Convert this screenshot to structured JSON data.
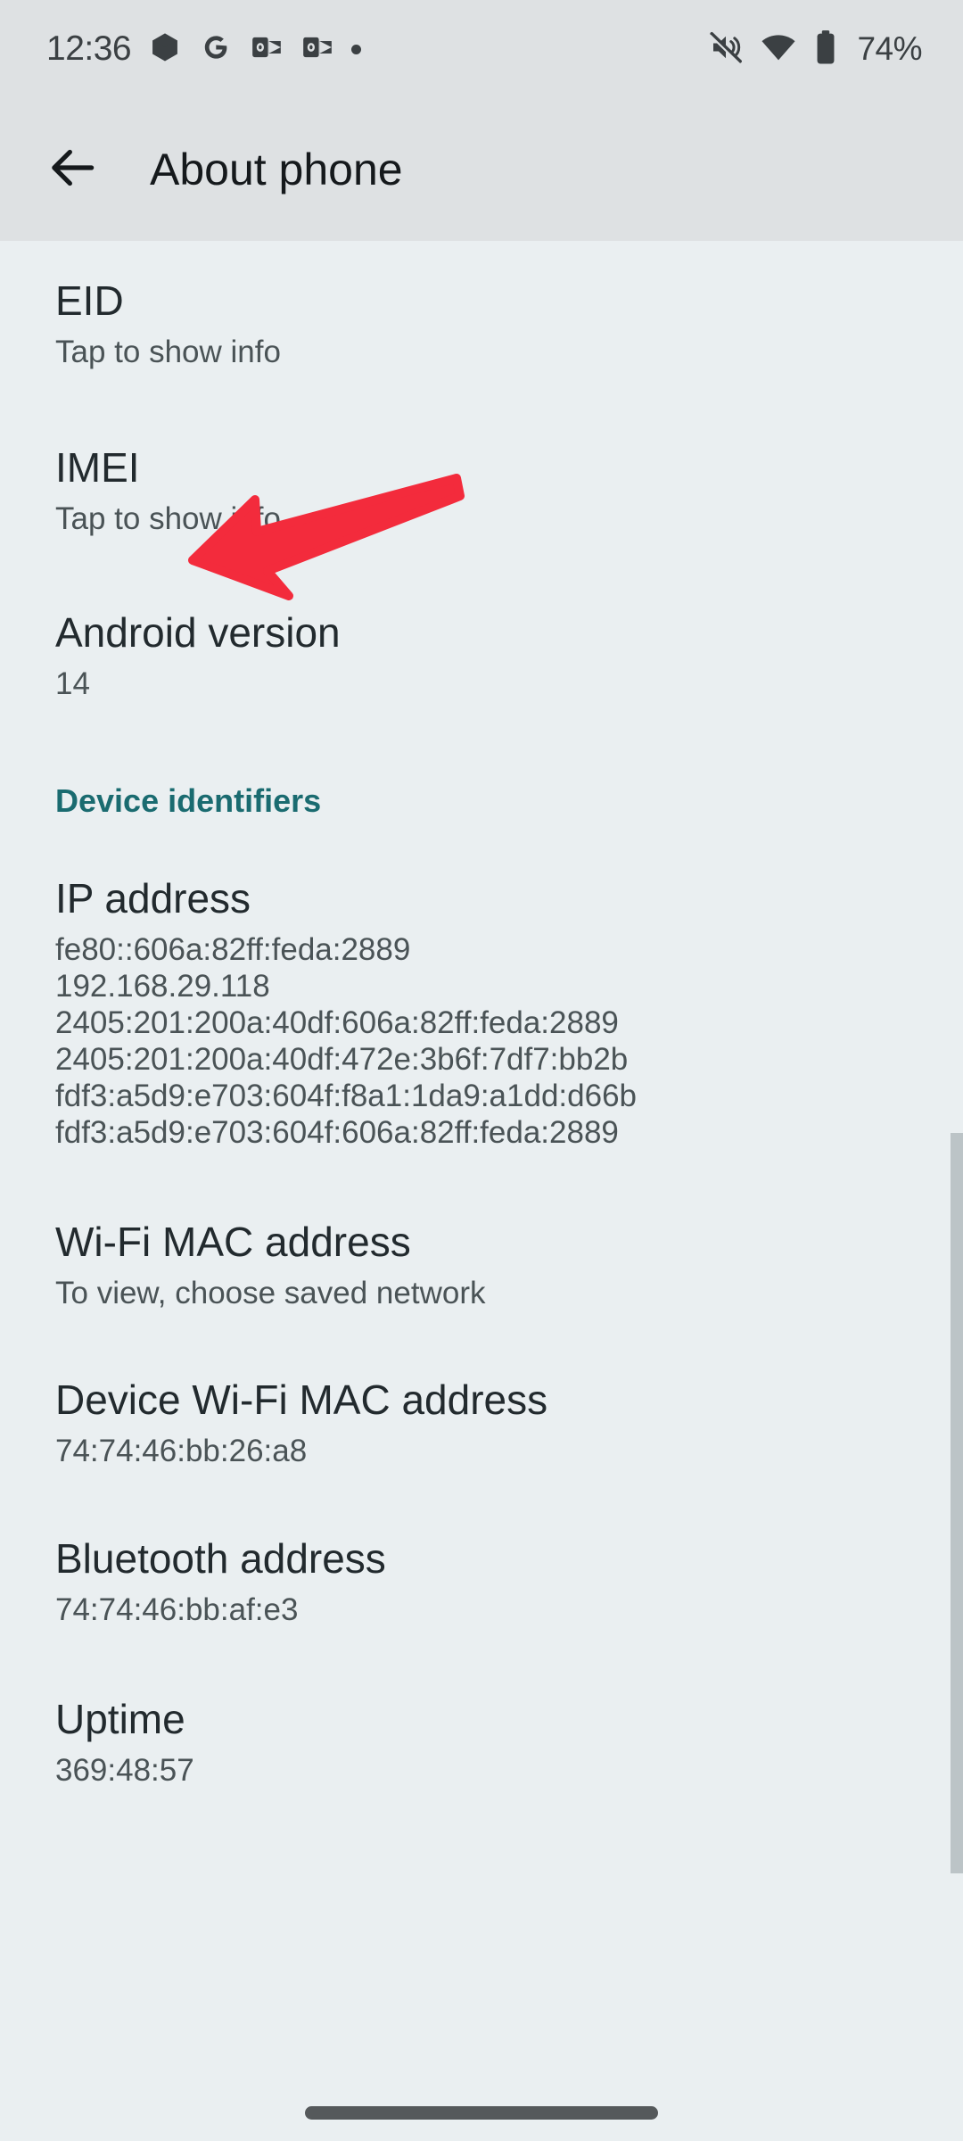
{
  "status_bar": {
    "clock": "12:36",
    "battery_percent": "74%",
    "left_icons": [
      "drive-icon",
      "google-icon",
      "outlook-icon",
      "outlook-icon",
      "notification-dot-icon"
    ],
    "right_icons": [
      "volume-off-icon",
      "wifi-icon",
      "battery-icon"
    ]
  },
  "app_bar": {
    "title": "About phone",
    "back_icon": "back-arrow-icon"
  },
  "colors": {
    "app_bar_bg": "#dee1e3",
    "content_bg": "#eaeff1",
    "section_header": "#1a6b70",
    "annotation_red": "#f32b3c",
    "title_text": "#222a2e",
    "sub_text": "#4a5356"
  },
  "clipped_top_item": "",
  "items": [
    {
      "title": "EID",
      "values": [
        "Tap to show info"
      ]
    },
    {
      "title": "IMEI",
      "values": [
        "Tap to show info"
      ]
    },
    {
      "title": "Android version",
      "values": [
        "14"
      ]
    }
  ],
  "section_device_identifiers": "Device identifiers",
  "items2": [
    {
      "title": "IP address",
      "values": [
        "fe80::606a:82ff:feda:2889",
        "192.168.29.118",
        "2405:201:200a:40df:606a:82ff:feda:2889",
        "2405:201:200a:40df:472e:3b6f:7df7:bb2b",
        "fdf3:a5d9:e703:604f:f8a1:1da9:a1dd:d66b",
        "fdf3:a5d9:e703:604f:606a:82ff:feda:2889"
      ]
    },
    {
      "title": "Wi-Fi MAC address",
      "values": [
        "To view, choose saved network"
      ]
    },
    {
      "title": "Device Wi-Fi MAC address",
      "values": [
        "74:74:46:bb:26:a8"
      ]
    },
    {
      "title": "Bluetooth address",
      "values": [
        "74:74:46:bb:af:e3"
      ]
    },
    {
      "title": "Uptime",
      "values": [
        "369:48:57"
      ]
    }
  ],
  "annotation": {
    "type": "arrow",
    "points_to": "IMEI",
    "color": "#f32b3c"
  },
  "nav_bar": {
    "gesture_pill": "home-gesture-pill"
  }
}
